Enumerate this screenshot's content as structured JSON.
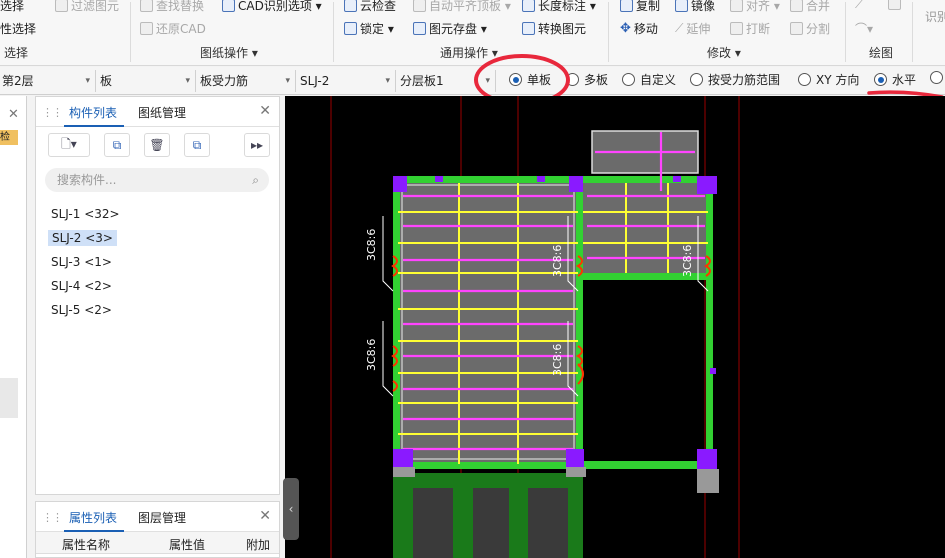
{
  "ribbon": {
    "row1": [
      {
        "label": "选择",
        "dim": false
      },
      {
        "label": "过滤图元",
        "dim": true
      },
      {
        "label": "查找替换",
        "dim": true
      },
      {
        "label": "CAD识别选项 ▾",
        "dim": false
      },
      {
        "label": "云检查",
        "dim": false
      },
      {
        "label": "自动平齐顶板 ▾",
        "dim": true
      },
      {
        "label": "长度标注 ▾",
        "dim": false
      },
      {
        "label": "复制",
        "dim": false
      },
      {
        "label": "镜像",
        "dim": false
      },
      {
        "label": "对齐 ▾",
        "dim": true
      },
      {
        "label": "合并",
        "dim": true
      }
    ],
    "row2": [
      {
        "label": "性选择",
        "dim": false
      },
      {
        "label": "还原CAD",
        "dim": true
      },
      {
        "label": "锁定 ▾",
        "dim": false
      },
      {
        "label": "图元存盘 ▾",
        "dim": false
      },
      {
        "label": "转换图元",
        "dim": false
      },
      {
        "label": "移动",
        "dim": false
      },
      {
        "label": "延伸",
        "dim": true
      },
      {
        "label": "打断",
        "dim": true
      },
      {
        "label": "分割",
        "dim": true
      }
    ],
    "groups": {
      "select": "选择",
      "drawing_ops": "图纸操作 ▾",
      "general_ops": "通用操作 ▾",
      "modify": "修改 ▾",
      "draw": "绘图",
      "recognize": "识别"
    }
  },
  "toolbar": {
    "floor": "第2层",
    "category": "板",
    "type": "板受力筋",
    "component": "SLJ-2",
    "layer": "分层板1",
    "radios": [
      {
        "label": "单板",
        "checked": true
      },
      {
        "label": "多板",
        "checked": false
      },
      {
        "label": "自定义",
        "checked": false
      },
      {
        "label": "按受力筋范围",
        "checked": false
      },
      {
        "label": "XY 方向",
        "checked": false
      },
      {
        "label": "水平",
        "checked": true
      },
      {
        "label": "",
        "checked": false
      }
    ]
  },
  "left_strip": {
    "tag": "检验"
  },
  "component_panel": {
    "tab_list": "构件列表",
    "tab_drawings": "图纸管理",
    "search_placeholder": "搜索构件...",
    "items": [
      {
        "label": "SLJ-1 <32>",
        "selected": false
      },
      {
        "label": "SLJ-2 <3>",
        "selected": true
      },
      {
        "label": "SLJ-3 <1>",
        "selected": false
      },
      {
        "label": "SLJ-4 <2>",
        "selected": false
      },
      {
        "label": "SLJ-5 <2>",
        "selected": false
      }
    ]
  },
  "property_panel": {
    "tab_props": "属性列表",
    "tab_layers": "图层管理",
    "col_name": "属性名称",
    "col_value": "属性值",
    "col_extra": "附加"
  },
  "canvas": {
    "rebar_labels": [
      "3C8:6",
      "3C8:6",
      "3C8:6",
      "3C8:6",
      "3C8:6"
    ],
    "colors": {
      "background": "#000000",
      "beam": "#32d132",
      "slab": "#6b6b6b",
      "rebar_x": "#ffff33",
      "rebar_y": "#ff44ff",
      "column": "#8a1aff",
      "axis": "#b00000"
    }
  }
}
